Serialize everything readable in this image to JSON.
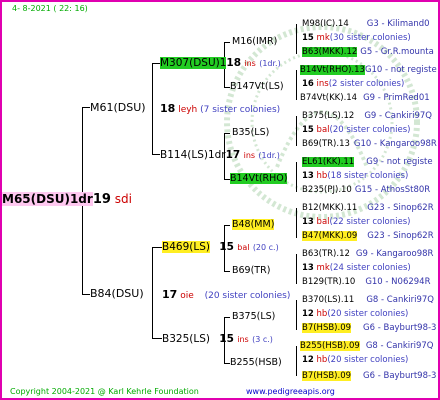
{
  "header": {
    "date": "4- 8-2021 ( 22: 16)"
  },
  "root": {
    "name": "M65(DSU)1dr",
    "num": "19",
    "note": "sdi"
  },
  "g1": {
    "top": {
      "name": "M61(DSU)",
      "num": "18",
      "note": "leyh",
      "sis": "(7 sister colonies)"
    },
    "bot": {
      "name": "B84(DSU)",
      "num": "17",
      "note": "oie",
      "sis": "(20 sister colonies)"
    }
  },
  "g2": {
    "a": {
      "name": "M307(DSU)1",
      "num": "18",
      "note": "ins",
      "sis": "(1dr.)"
    },
    "b": {
      "name": "B114(LS)1dr",
      "num": "17",
      "note": "ins",
      "sis": "(1dr.)"
    },
    "c": {
      "name": "B469(LS)",
      "num": "15",
      "note": "bal",
      "sis": "(20 c.)"
    },
    "d": {
      "name": "B325(LS)",
      "num": "15",
      "note": "ins",
      "sis": "(3 c.)"
    }
  },
  "g3": {
    "a": {
      "name": "M16(IMR)",
      "num": "15",
      "note": "mk",
      "sis": "(30 sister colonies)"
    },
    "b": {
      "name": "B147Vt(LS)",
      "num": "16",
      "note": "ins",
      "sis": "(2 sister colonies)"
    },
    "c": {
      "name": "B35(LS)",
      "num": "15",
      "note": "bal",
      "sis": "(20 sister colonies)"
    },
    "d": {
      "name": "B14Vt(RHO)",
      "num": "13",
      "note": "hb",
      "sis": "(18 sister colonies)"
    },
    "e": {
      "name": "B48(MM)",
      "num": "13",
      "note": "bal",
      "sis": "(22 sister colonies)"
    },
    "f": {
      "name": "B69(TR)",
      "num": "13",
      "note": "mk",
      "sis": "(24 sister colonies)"
    },
    "g": {
      "name": "B375(LS)",
      "num": "12",
      "note": "hb",
      "sis": "(20 sister colonies)"
    },
    "h": {
      "name": "B255(HSB)",
      "num": "12",
      "note": "hb",
      "sis": "(20 sister colonies)"
    }
  },
  "g4": [
    {
      "name": "M98(IC).14",
      "info": "G3 - Kilimand0"
    },
    {
      "name": "B63(MKK).12",
      "info": "G5 - Gr.R.mounta"
    },
    {
      "name": "B14Vt(RHO).13",
      "info": "G10 - not registe"
    },
    {
      "name": "B74Vt(KK).14",
      "info": "G9 - PrimRed01"
    },
    {
      "name": "B375(LS).12",
      "info": "G9 - Cankiri97Q"
    },
    {
      "name": "B69(TR).13",
      "info": "G10 - Kangaroo98R"
    },
    {
      "name": "EL61(KK).11",
      "info": "G9 - not registe"
    },
    {
      "name": "B235(PJ).10",
      "info": "G15 - AthosSt80R"
    },
    {
      "name": "B12(MKK).11",
      "info": "G23 - Sinop62R"
    },
    {
      "name": "B47(MKK).09",
      "info": "G23 - Sinop62R"
    },
    {
      "name": "B63(TR).12",
      "info": "G9 - Kangaroo98R"
    },
    {
      "name": "B129(TR).10",
      "info": "G10 - N06294R"
    },
    {
      "name": "B370(LS).11",
      "info": "G8 - Cankiri97Q"
    },
    {
      "name": "B7(HSB).09",
      "info": "G6 - Bayburt98-3"
    },
    {
      "name": "B255(HSB).09",
      "info": "G8 - Cankiri97Q"
    },
    {
      "name": "B7(HSB).09",
      "info": "G6 - Bayburt98-3"
    }
  ],
  "footer": {
    "copyright": "Copyright 2004-2021 @ Karl Kehrle Foundation",
    "url": "www.pedigreeapis.org"
  }
}
